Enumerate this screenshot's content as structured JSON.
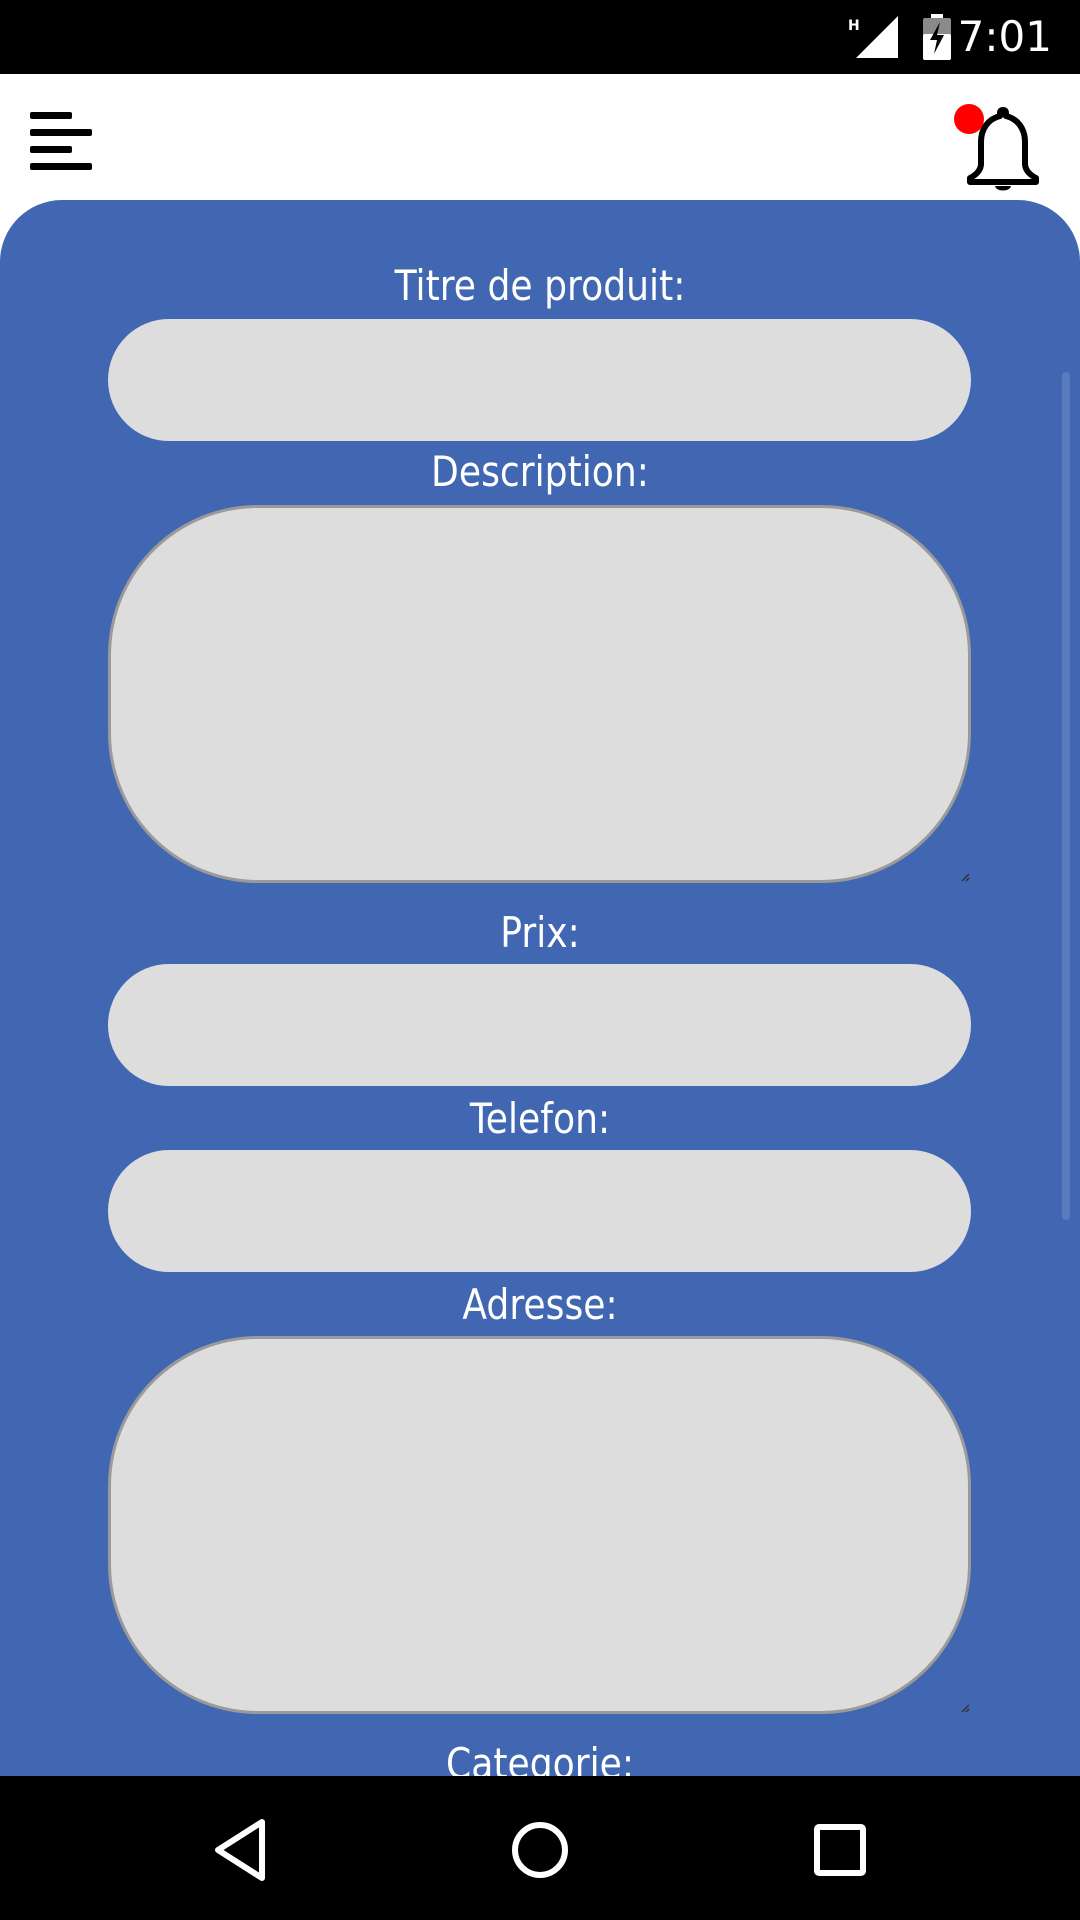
{
  "status_bar": {
    "time": "7:01",
    "network_label": "H",
    "icons": [
      "signal-icon",
      "battery-charging-icon"
    ]
  },
  "app_bar": {
    "menu_icon": "menu-icon",
    "notification_icon": "bell-icon",
    "has_unread_notification": true
  },
  "form": {
    "title_label": "Titre de produit:",
    "title_value": "",
    "description_label": "Description:",
    "description_value": "",
    "price_label": "Prix:",
    "price_value": "",
    "phone_label": "Telefon:",
    "phone_value": "",
    "address_label": "Adresse:",
    "address_value": "",
    "category_label": "Categorie:"
  },
  "navigation": {
    "back_icon": "back-icon",
    "home_icon": "home-icon",
    "recents_icon": "recents-icon"
  },
  "colors": {
    "panel": "#4267b2",
    "field": "#dddddd",
    "notification_dot": "#ff0000",
    "status_bar": "#000000"
  }
}
